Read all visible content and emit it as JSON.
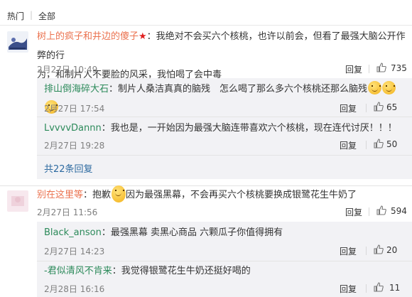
{
  "tabs": {
    "hot": "热门",
    "sep": "|",
    "all": "全部"
  },
  "comments": [
    {
      "user": "树上的疯子和井边的傻子",
      "badge": "★",
      "line1": "：我绝对不会买六个核桃，也许以前会，但看了最强大脑公开作弊的行",
      "line2": "为，和制片人不要脸的风采，我怕喝了会中毒",
      "time": "2月27日 10:49",
      "reply": "回复",
      "likes": "735",
      "replies": [
        {
          "user": "排山倒海碎大石",
          "text": "：制片人桑洁真真的脑残　怎么喝了那么多六个核桃还那么脑残",
          "time": "2月27日 17:54",
          "reply": "回复",
          "likes": "65"
        },
        {
          "user": "LvvvvDannn",
          "text": "：我也是，一开始因为最强大脑连带喜欢六个核桃，现在连代讨厌！！！",
          "time": "2月27日 19:28",
          "reply": "回复",
          "likes": "50"
        }
      ],
      "more": "共22条回复"
    },
    {
      "user": "别在这里等",
      "text_a": "：抱歉",
      "text_b": "因为最强黑幕，不会再买六个核桃要换成银鹭花生牛奶了",
      "time": "2月27日 11:56",
      "reply": "回复",
      "likes": "594",
      "replies": [
        {
          "user": "Black_anson",
          "text": "：最强黑幕 卖黑心商品 六颗瓜子你值得拥有",
          "time": "2月27日 14:23",
          "reply": "回复",
          "likes": "20"
        },
        {
          "user": "-君似清风不肯来",
          "text": "：我觉得银鹭花生牛奶还挺好喝的",
          "time": "2月28日 16:16",
          "reply": "回复",
          "likes": "11"
        }
      ]
    }
  ],
  "icons": {
    "like": "thumbs-up-icon",
    "emoji": "emoji-icon",
    "avatar1": "avatar",
    "avatar2": "avatar"
  },
  "colors": {
    "username": "#eb7350",
    "link": "#2d6aa0",
    "muted": "#808080",
    "sub_bg": "#f2f2f5"
  }
}
